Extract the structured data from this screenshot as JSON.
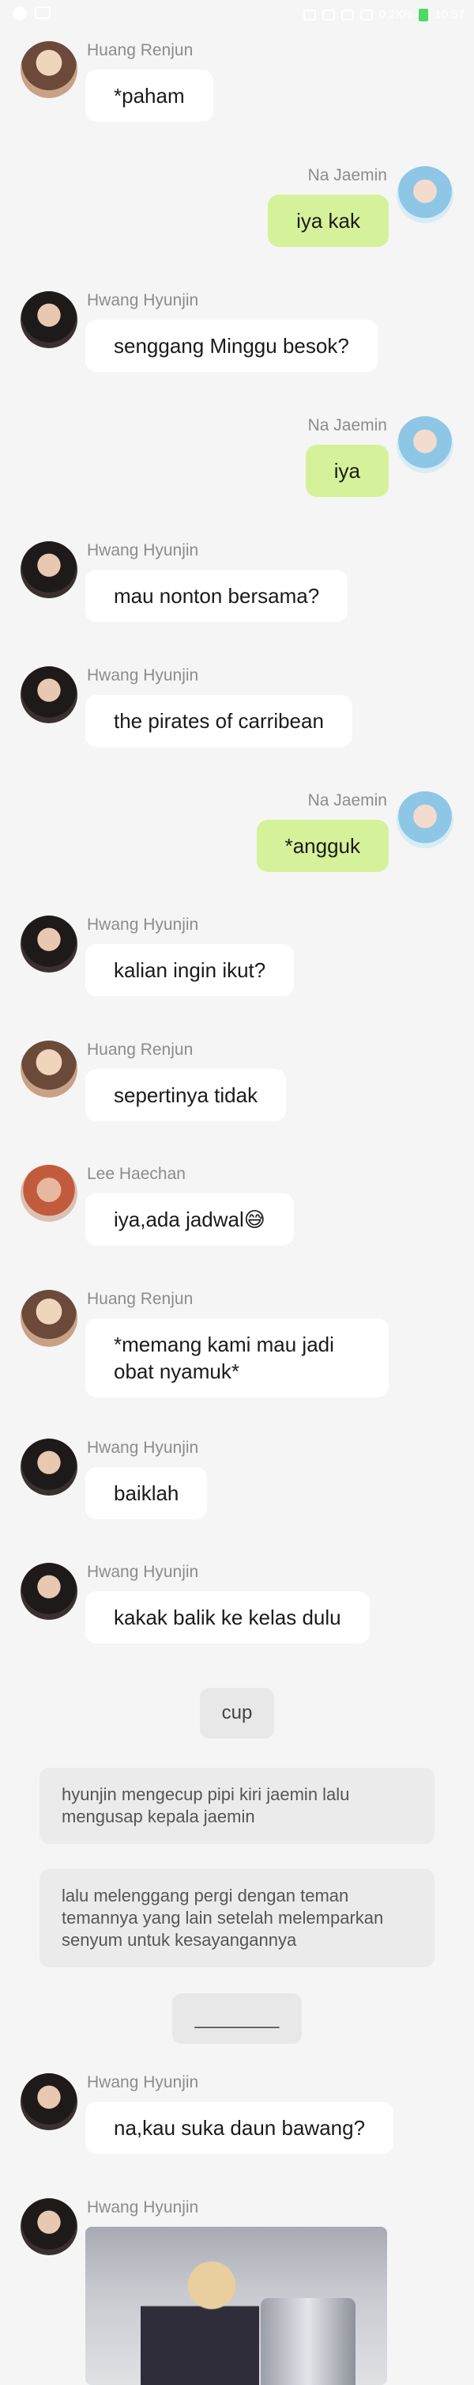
{
  "status_bar": {
    "time": "10:57",
    "network": "0,2K/s"
  },
  "messages": [
    {
      "side": "left",
      "sender": "Huang Renjun",
      "avatar": "renjun",
      "text": "*paham"
    },
    {
      "side": "right",
      "sender": "Na Jaemin",
      "avatar": "jaemin",
      "text": "iya kak"
    },
    {
      "side": "left",
      "sender": "Hwang Hyunjin",
      "avatar": "hyunjin",
      "text": "senggang Minggu besok?"
    },
    {
      "side": "right",
      "sender": "Na Jaemin",
      "avatar": "jaemin",
      "text": "iya"
    },
    {
      "side": "left",
      "sender": "Hwang Hyunjin",
      "avatar": "hyunjin",
      "text": "mau nonton bersama?"
    },
    {
      "side": "left",
      "sender": "Hwang Hyunjin",
      "avatar": "hyunjin",
      "text": "the pirates of carribean"
    },
    {
      "side": "right",
      "sender": "Na Jaemin",
      "avatar": "jaemin",
      "text": "*angguk"
    },
    {
      "side": "left",
      "sender": "Hwang Hyunjin",
      "avatar": "hyunjin",
      "text": "kalian ingin ikut?"
    },
    {
      "side": "left",
      "sender": "Huang Renjun",
      "avatar": "renjun",
      "text": "sepertinya tidak"
    },
    {
      "side": "left",
      "sender": "Lee Haechan",
      "avatar": "haechan",
      "text": "iya,ada jadwal😅"
    },
    {
      "side": "left",
      "sender": "Huang Renjun",
      "avatar": "renjun",
      "text": "*memang kami mau jadi obat nyamuk*"
    },
    {
      "side": "left",
      "sender": "Hwang Hyunjin",
      "avatar": "hyunjin",
      "text": "baiklah"
    },
    {
      "side": "left",
      "sender": "Hwang Hyunjin",
      "avatar": "hyunjin",
      "text": "kakak balik ke kelas dulu"
    }
  ],
  "center_label_1": "cup",
  "narration": [
    "hyunjin mengecup pipi kiri jaemin lalu mengusap kepala jaemin",
    "lalu melenggang pergi dengan teman temannya yang lain setelah melemparkan senyum untuk kesayangannya"
  ],
  "center_label_2": "________",
  "after": [
    {
      "side": "left",
      "sender": "Hwang Hyunjin",
      "avatar": "hyunjin",
      "text": "na,kau suka daun bawang?"
    },
    {
      "side": "left",
      "sender": "Hwang Hyunjin",
      "avatar": "hyunjin",
      "text": ""
    }
  ]
}
